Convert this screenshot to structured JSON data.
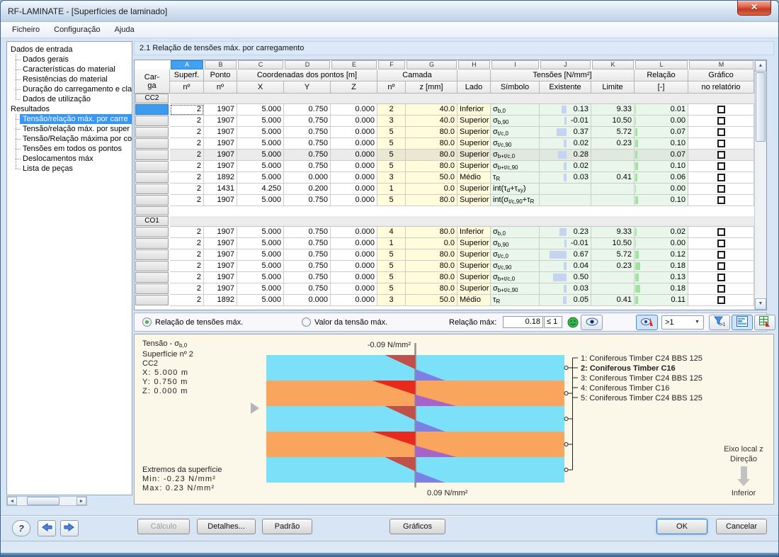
{
  "window": {
    "title": "RF-LAMINATE - [Superfícies de laminado]",
    "close_icon": "✕"
  },
  "menu": {
    "items": [
      "Ficheiro",
      "Configuração",
      "Ajuda"
    ]
  },
  "sidebar": {
    "input_header": "Dados de entrada",
    "input_items": [
      "Dados gerais",
      "Características do material",
      "Resistências do material",
      "Duração do carregamento e cla",
      "Dados de utilização"
    ],
    "results_header": "Resultados",
    "results_items": [
      "Tensão/relação máx. por carre",
      "Tensão/relação máx. por super",
      "Tensão/Relação máxima por co",
      "Tensões em todos os pontos",
      "Deslocamentos máx",
      "Lista de peças"
    ],
    "selected_result": 0
  },
  "section_title": "2.1 Relação de tensões máx. por carregamento",
  "table": {
    "letters": [
      "A",
      "B",
      "C",
      "D",
      "E",
      "F",
      "G",
      "H",
      "I",
      "J",
      "K",
      "L",
      "M"
    ],
    "selected_letter": "A",
    "h": {
      "carga1": "Car-",
      "carga2": "ga",
      "superf": "Superf.",
      "ponto": "Ponto",
      "no": "nº",
      "coords": "Coordenadas dos pontos [m]",
      "x": "X",
      "y": "Y",
      "z": "Z",
      "camada": "Camada",
      "zmm": "z [mm]",
      "lado": "Lado",
      "tensoes": "Tensões [N/mm²]",
      "simbolo": "Símbolo",
      "existente": "Existente",
      "limite": "Limite",
      "relacao": "Relação",
      "rel_unit": "[-]",
      "grafico": "Gráfico",
      "norel": "no relatório"
    },
    "groups": [
      {
        "band": "CC2",
        "rows": [
          {
            "c": [
              "2",
              "1907",
              "5.000",
              "0.750",
              "0.000",
              "2",
              "40.0",
              "Inferior"
            ],
            "sym": "σ_{b,0}",
            "ex": "0.13",
            "lim": "9.33",
            "rel": "0.01",
            "f": true,
            "cur": true
          },
          {
            "c": [
              "2",
              "1907",
              "5.000",
              "0.750",
              "0.000",
              "3",
              "40.0",
              "Superior"
            ],
            "sym": "σ_{b,90}",
            "ex": "-0.01",
            "lim": "10.50",
            "rel": "0.00"
          },
          {
            "c": [
              "2",
              "1907",
              "5.000",
              "0.750",
              "0.000",
              "5",
              "80.0",
              "Superior"
            ],
            "sym": "σ_{t/c,0}",
            "ex": "0.37",
            "lim": "5.72",
            "rel": "0.07"
          },
          {
            "c": [
              "2",
              "1907",
              "5.000",
              "0.750",
              "0.000",
              "5",
              "80.0",
              "Superior"
            ],
            "sym": "σ_{t/c,90}",
            "ex": "0.02",
            "lim": "0.23",
            "rel": "0.10"
          },
          {
            "c": [
              "2",
              "1907",
              "5.000",
              "0.750",
              "0.000",
              "5",
              "80.0",
              "Superior"
            ],
            "sym": "σ_{b+t/c,0}",
            "ex": "0.28",
            "lim": "",
            "rel": "0.07",
            "hl": true
          },
          {
            "c": [
              "2",
              "1907",
              "5.000",
              "0.750",
              "0.000",
              "5",
              "80.0",
              "Superior"
            ],
            "sym": "σ_{b+t/c,90}",
            "ex": "0.02",
            "lim": "",
            "rel": "0.10"
          },
          {
            "c": [
              "2",
              "1892",
              "5.000",
              "0.000",
              "0.000",
              "3",
              "50.0",
              "Médio"
            ],
            "sym": "τ_{R}",
            "ex": "0.03",
            "lim": "0.41",
            "rel": "0.06"
          },
          {
            "c": [
              "2",
              "1431",
              "4.250",
              "0.200",
              "0.000",
              "1",
              "0.0",
              "Superior"
            ],
            "sym": "int(τ_{d}+τ_{xy})",
            "ex": "",
            "lim": "",
            "rel": "0.00"
          },
          {
            "c": [
              "2",
              "1907",
              "5.000",
              "0.750",
              "0.000",
              "5",
              "80.0",
              "Superior"
            ],
            "sym": "int(σ_{t/c,90}+τ_{R}",
            "ex": "",
            "lim": "",
            "rel": "0.10"
          }
        ]
      },
      {
        "band": "CO1",
        "rows": [
          {
            "c": [
              "2",
              "1907",
              "5.000",
              "0.750",
              "0.000",
              "4",
              "80.0",
              "Inferior"
            ],
            "sym": "σ_{b,0}",
            "ex": "0.23",
            "lim": "9.33",
            "rel": "0.02"
          },
          {
            "c": [
              "2",
              "1907",
              "5.000",
              "0.750",
              "0.000",
              "1",
              "0.0",
              "Superior"
            ],
            "sym": "σ_{b,90}",
            "ex": "-0.01",
            "lim": "10.50",
            "rel": "0.00"
          },
          {
            "c": [
              "2",
              "1907",
              "5.000",
              "0.750",
              "0.000",
              "5",
              "80.0",
              "Superior"
            ],
            "sym": "σ_{t/c,0}",
            "ex": "0.67",
            "lim": "5.72",
            "rel": "0.12"
          },
          {
            "c": [
              "2",
              "1907",
              "5.000",
              "0.750",
              "0.000",
              "5",
              "80.0",
              "Superior"
            ],
            "sym": "σ_{t/c,90}",
            "ex": "0.04",
            "lim": "0.23",
            "rel": "0.18"
          },
          {
            "c": [
              "2",
              "1907",
              "5.000",
              "0.750",
              "0.000",
              "5",
              "80.0",
              "Superior"
            ],
            "sym": "σ_{b+t/c,0}",
            "ex": "0.50",
            "lim": "",
            "rel": "0.13"
          },
          {
            "c": [
              "2",
              "1907",
              "5.000",
              "0.750",
              "0.000",
              "5",
              "80.0",
              "Superior"
            ],
            "sym": "σ_{b+t/c,90}",
            "ex": "0.03",
            "lim": "",
            "rel": "0.18"
          },
          {
            "c": [
              "2",
              "1892",
              "5.000",
              "0.000",
              "0.000",
              "3",
              "50.0",
              "Médio"
            ],
            "sym": "τ_{R}",
            "ex": "0.05",
            "lim": "0.41",
            "rel": "0.11"
          }
        ]
      }
    ]
  },
  "controls": {
    "radio1": "Relação de tensões máx.",
    "radio2": "Valor da tensão máx.",
    "rel_label": "Relação máx:",
    "rel_value": "0.18",
    "rel_limit": "≤ 1",
    "dropdown": ">1"
  },
  "chart": {
    "info": {
      "title": "Tensão - σ_{b,0}",
      "surface": "Superfície nº 2",
      "case": "CC2",
      "cx": "X: 5.000 m",
      "cy": "Y: 0.750 m",
      "cz": "Z: 0.000 m",
      "extremes": "Extremos da superfície",
      "min": "Min: -0.23 N/mm²",
      "max": "Max: 0.23 N/mm²"
    },
    "top_label": "-0.09 N/mm²",
    "bottom_label": "0.09 N/mm²",
    "layers": [
      {
        "legend": "1: Coniferous Timber C24 BBS 125",
        "type": "cyan",
        "bold": false
      },
      {
        "legend": "2: Coniferous Timber C16",
        "type": "orange",
        "bold": true
      },
      {
        "legend": "3: Coniferous Timber C24 BBS 125",
        "type": "cyan",
        "bold": false
      },
      {
        "legend": "4: Coniferous Timber C16",
        "type": "orange",
        "bold": false
      },
      {
        "legend": "5: Coniferous Timber C24 BBS 125",
        "type": "cyan",
        "bold": false
      }
    ],
    "colors": {
      "cyan": "#7ce0f9",
      "orange": "#f9a55e",
      "neg_on_cyan": "#c0504a",
      "neg_on_orange": "#e8291c",
      "pos_on_cyan": "#7b80e4",
      "pos_on_orange": "#a763c8"
    },
    "axis": {
      "l1": "Eixo local z",
      "l2": "Direção",
      "l3": "Inferior"
    }
  },
  "footer": {
    "calc": "Cálculo",
    "details": "Detalhes...",
    "padrao": "Padrão",
    "graficos": "Gráficos",
    "ok": "OK",
    "cancel": "Cancelar"
  }
}
